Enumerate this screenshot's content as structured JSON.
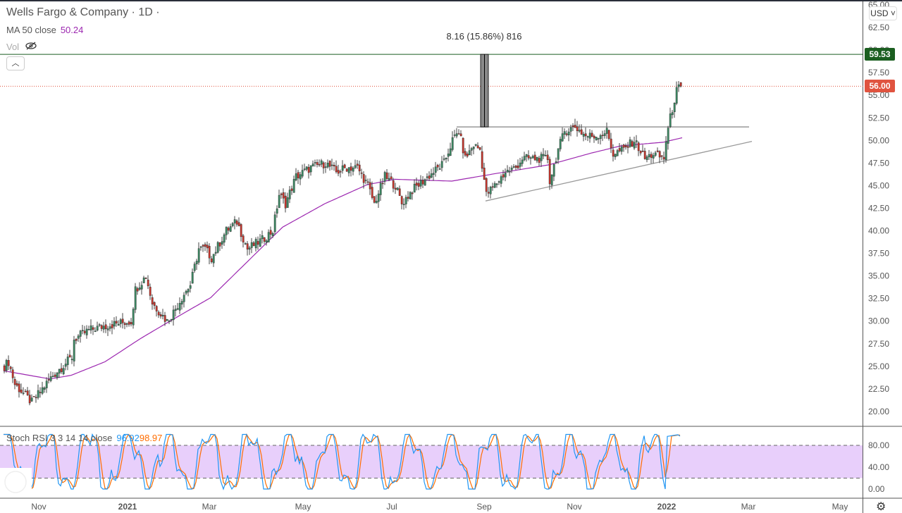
{
  "header": {
    "title": "Wells Fargo & Company · 1D ·",
    "ma_label": "MA 50 close",
    "ma_value": "50.24",
    "vol_label": "Vol",
    "collapse_icon": "chevron-up-icon",
    "visibility_icon": "eye-off-icon"
  },
  "price_axis": {
    "currency": "USD",
    "labels": [
      "65.00",
      "62.50",
      "60.00",
      "57.50",
      "55.00",
      "52.50",
      "50.00",
      "47.50",
      "45.00",
      "42.50",
      "40.00",
      "37.50",
      "35.00",
      "32.50",
      "30.00",
      "27.50",
      "25.00",
      "22.50",
      "20.00"
    ],
    "target_tag": "59.53",
    "last_tag": "56.00"
  },
  "measure": {
    "label": "8.16 (15.86%) 816"
  },
  "time_axis": {
    "labels": [
      "Nov",
      "2021",
      "Mar",
      "May",
      "Jul",
      "Sep",
      "Nov",
      "2022",
      "Mar",
      "May"
    ]
  },
  "stoch": {
    "label": "Stoch RSI 3 3 14 14 close",
    "k": "96.92",
    "d": "98.97",
    "axis": [
      "80.00",
      "40.00",
      "0.00"
    ]
  },
  "colors": {
    "up": "#3d8a64",
    "down": "#c9362d",
    "ma": "#9c27b0",
    "k": "#2196f3",
    "d": "#ff6d00",
    "band": "#e8cffb",
    "target": "#1b5e20",
    "last": "#e0533f"
  },
  "chart_data": {
    "type": "candlestick",
    "title": "Wells Fargo & Company",
    "interval": "1D",
    "ylim": [
      18,
      65
    ],
    "close_path": [
      [
        0,
        25
      ],
      [
        2,
        25.5
      ],
      [
        5,
        23
      ],
      [
        13,
        21
      ],
      [
        18,
        22.5
      ],
      [
        23,
        24
      ],
      [
        32,
        26
      ],
      [
        33,
        28
      ],
      [
        40,
        29
      ],
      [
        48,
        29.5
      ],
      [
        60,
        30
      ],
      [
        62,
        33.5
      ],
      [
        67,
        35
      ],
      [
        70,
        32
      ],
      [
        77,
        30
      ],
      [
        80,
        31
      ],
      [
        85,
        33
      ],
      [
        88,
        34
      ],
      [
        92,
        38
      ],
      [
        95,
        38
      ],
      [
        98,
        37
      ],
      [
        105,
        40
      ],
      [
        110,
        41
      ],
      [
        115,
        38
      ],
      [
        122,
        39
      ],
      [
        127,
        40
      ],
      [
        130,
        44
      ],
      [
        133,
        43
      ],
      [
        138,
        46
      ],
      [
        145,
        47
      ],
      [
        152,
        47.5
      ],
      [
        157,
        46.5
      ],
      [
        162,
        47
      ],
      [
        167,
        47
      ],
      [
        172,
        45
      ],
      [
        175,
        43
      ],
      [
        180,
        46
      ],
      [
        185,
        45
      ],
      [
        188,
        43
      ],
      [
        193,
        44.5
      ],
      [
        198,
        45.5
      ],
      [
        203,
        46.5
      ],
      [
        208,
        47.5
      ],
      [
        212,
        50
      ],
      [
        215,
        51
      ],
      [
        218,
        48
      ],
      [
        222,
        49.5
      ],
      [
        225,
        49
      ],
      [
        228,
        44
      ],
      [
        232,
        45
      ],
      [
        237,
        46.5
      ],
      [
        242,
        47
      ],
      [
        245,
        48
      ],
      [
        252,
        48
      ],
      [
        257,
        48
      ],
      [
        258,
        45.5
      ],
      [
        262,
        49
      ],
      [
        265,
        51
      ],
      [
        270,
        51.5
      ],
      [
        275,
        50.5
      ],
      [
        280,
        50.5
      ],
      [
        285,
        51
      ],
      [
        288,
        48.5
      ],
      [
        293,
        49
      ],
      [
        298,
        50
      ],
      [
        303,
        48
      ],
      [
        307,
        48.5
      ],
      [
        312,
        48
      ],
      [
        313,
        50
      ],
      [
        315,
        52.5
      ],
      [
        318,
        55.5
      ],
      [
        320,
        56
      ]
    ],
    "ma50_path": [
      [
        0,
        24.5
      ],
      [
        22,
        23.6
      ],
      [
        32,
        24.0
      ],
      [
        48,
        25.5
      ],
      [
        65,
        28.1
      ],
      [
        78,
        29.9
      ],
      [
        98,
        32.6
      ],
      [
        132,
        40.4
      ],
      [
        152,
        43
      ],
      [
        172,
        45.1
      ],
      [
        185,
        45.7
      ],
      [
        212,
        45.5
      ],
      [
        232,
        46.3
      ],
      [
        258,
        47.3
      ],
      [
        278,
        48.6
      ],
      [
        292,
        49.4
      ],
      [
        312,
        49.8
      ],
      [
        321,
        50.3
      ]
    ],
    "resistance": 51.5,
    "target": 59.53,
    "last": 56.0,
    "trendline": [
      [
        228,
        43.3
      ],
      [
        354,
        49.9
      ]
    ]
  }
}
